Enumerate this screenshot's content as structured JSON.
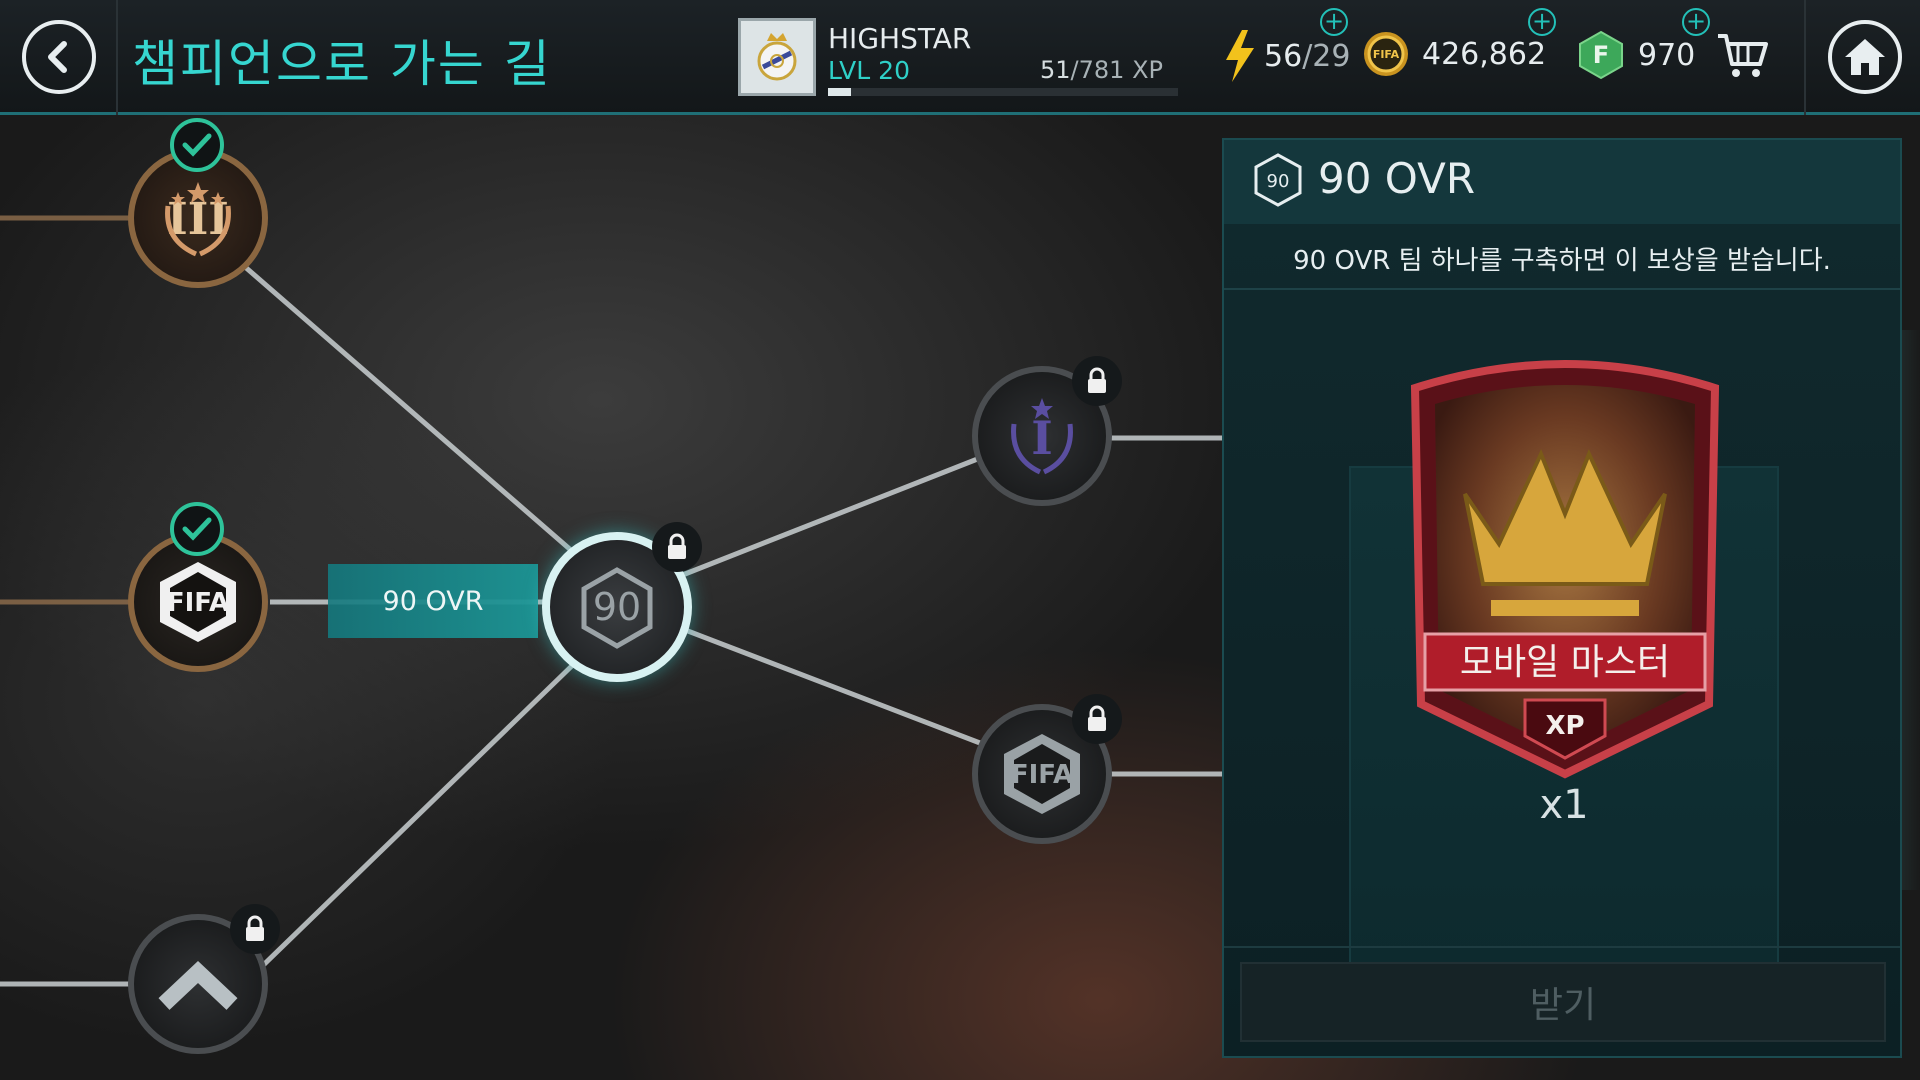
{
  "header": {
    "title": "챔피언으로 가는 길",
    "player": {
      "name": "HIGHSTAR",
      "level": "LVL 20",
      "xp_current": "51",
      "xp_total": "/781 XP",
      "xp_progress": 0.065
    },
    "stamina": {
      "value": "56",
      "max": "/29"
    },
    "coins": "426,862",
    "fifa_points": "970"
  },
  "map": {
    "selected_label": "90 OVR",
    "nodes": [
      {
        "name": "milestone-III",
        "status": "completed"
      },
      {
        "name": "fifa-badge",
        "status": "completed"
      },
      {
        "name": "90-ovr",
        "status": "locked",
        "text": "90"
      },
      {
        "name": "milestone-I",
        "status": "locked"
      },
      {
        "name": "fifa-badge-2",
        "status": "locked"
      },
      {
        "name": "rank-up",
        "status": "locked"
      }
    ]
  },
  "panel": {
    "badge": "90",
    "title": "90 OVR",
    "description": "90 OVR 팀 하나를 구축하면 이 보상을 받습니다.",
    "reward": {
      "name": "모바일 마스터",
      "tag": "XP",
      "quantity": "x1"
    },
    "claim_label": "받기"
  },
  "colors": {
    "accent": "#2fd0c8",
    "check": "#2ec39a",
    "reward_red": "#b01d2a",
    "gold": "#d7a63c"
  }
}
